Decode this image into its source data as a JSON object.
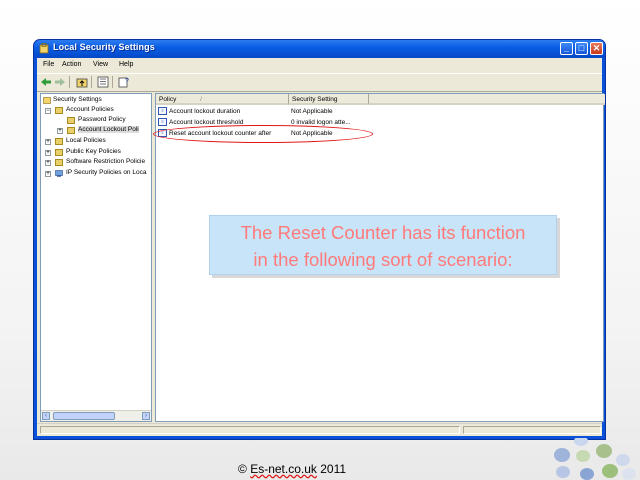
{
  "window": {
    "title": "Local Security Settings",
    "controls": {
      "minimize": "_",
      "maximize": "□",
      "close": "✕"
    }
  },
  "menubar": [
    "File",
    "Action",
    "View",
    "Help"
  ],
  "toolbar": {
    "icons": [
      "back-arrow-icon",
      "forward-arrow-icon",
      "up-folder-icon",
      "show-hide-tree-icon",
      "help-icon"
    ]
  },
  "tree": {
    "root": "Security Settings",
    "account_policies": "Account Policies",
    "password_policy": "Password Policy",
    "account_lockout_policy": "Account Lockout Poli",
    "local_policies": "Local Policies",
    "public_key_policies": "Public Key Policies",
    "software_restriction_policies": "Software Restriction Policie",
    "ip_security_policies": "IP Security Policies on Loca"
  },
  "list": {
    "columns": {
      "policy": "Policy",
      "sort_indicator": "/",
      "setting": "Security Setting"
    },
    "rows": [
      {
        "policy": "Account lockout duration",
        "setting": "Not Applicable"
      },
      {
        "policy": "Account lockout threshold",
        "setting": "0 invalid logon atte..."
      },
      {
        "policy": "Reset account lockout counter after",
        "setting": "Not Applicable"
      }
    ]
  },
  "callout": {
    "line1": "The Reset Counter has its function",
    "line2": "in the following sort of scenario:"
  },
  "footer": {
    "copyright": "© ",
    "squiggled": "Es-net.co.uk",
    "year": " 2011"
  },
  "colors": {
    "titlebar": "#0a5ee4",
    "callout_bg": "#c8e4f8",
    "callout_text": "#ff7a7a",
    "highlight_ellipse": "#e01818"
  }
}
